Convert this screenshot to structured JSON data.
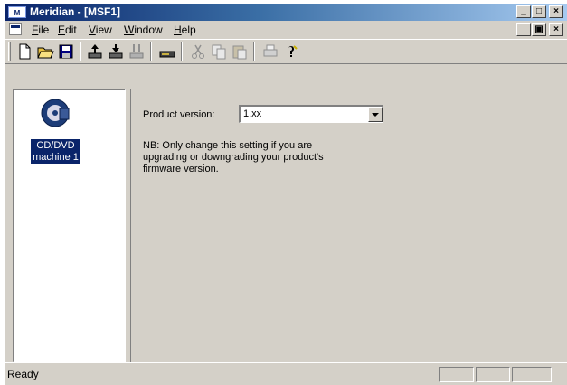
{
  "window": {
    "title": "Meridian - [MSF1]",
    "app_icon_text": "M"
  },
  "title_buttons": {
    "minimize": "_",
    "maximize": "□",
    "close": "×"
  },
  "mdi_buttons": {
    "minimize": "_",
    "restore": "▣",
    "close": "×"
  },
  "menu": [
    {
      "label": "File",
      "mnemonic": "F",
      "rest": "ile"
    },
    {
      "label": "Edit",
      "mnemonic": "E",
      "rest": "dit"
    },
    {
      "label": "View",
      "mnemonic": "V",
      "rest": "iew"
    },
    {
      "label": "Window",
      "mnemonic": "W",
      "rest": "indow"
    },
    {
      "label": "Help",
      "mnemonic": "H",
      "rest": "elp"
    }
  ],
  "toolbar": {
    "icons": [
      "new-icon",
      "open-icon",
      "save-icon",
      "upload-icon",
      "download-icon",
      "compare-icon",
      "device-icon",
      "cut-icon",
      "copy-icon",
      "paste-icon",
      "print-icon",
      "help-icon"
    ]
  },
  "tree": {
    "device_label_line1": "CD/DVD",
    "device_label_line2": "machine 1"
  },
  "settings": {
    "product_version_label": "Product version:",
    "product_version_value": "1.xx",
    "note_line1": "NB: Only change this setting if you are",
    "note_line2": "upgrading or downgrading your product's",
    "note_line3": "firmware version."
  },
  "status": {
    "text": "Ready"
  },
  "colors": {
    "title_bar": "#0a246a",
    "face": "#d4d0c8",
    "selection": "#0a246a"
  }
}
